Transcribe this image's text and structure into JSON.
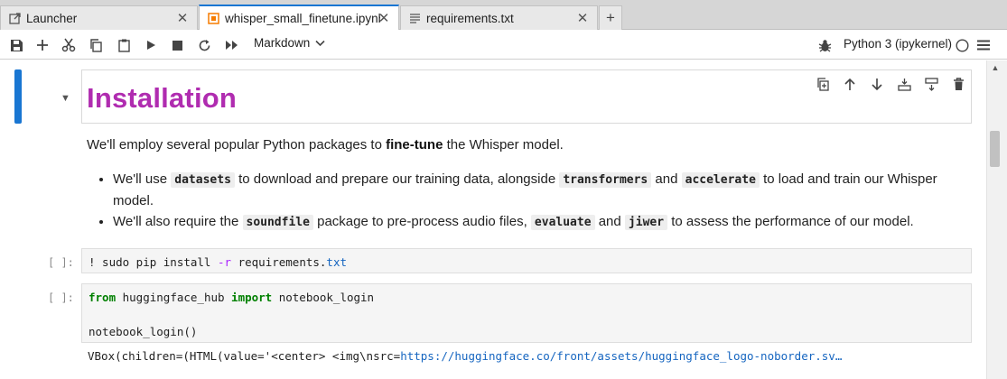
{
  "tabs": [
    {
      "label": "Launcher",
      "icon": "external-launch-icon",
      "active": false
    },
    {
      "label": "whisper_small_finetune.ipynb",
      "icon": "notebook-icon",
      "active": true
    },
    {
      "label": "requirements.txt",
      "icon": "text-file-icon",
      "active": false
    }
  ],
  "new_tab_label": "+",
  "toolbar": {
    "cell_type": "Markdown",
    "kernel_name": "Python 3 (ipykernel)"
  },
  "notebook": {
    "heading": "Installation",
    "intro": {
      "before": "We'll employ several popular Python packages to ",
      "bold": "fine-tune",
      "after": " the Whisper model."
    },
    "bullets": [
      {
        "p1": "We'll use ",
        "c1": "datasets",
        "p2": " to download and prepare our training data, alongside ",
        "c2": "transformers",
        "p3": " and ",
        "c3": "accelerate",
        "p4": " to load and train our Whisper model."
      },
      {
        "p1": "We'll also require the ",
        "c1": "soundfile",
        "p2": " package to pre-process audio files, ",
        "c2": "evaluate",
        "p3": " and ",
        "c3": "jiwer",
        "p4": " to assess the performance of our model."
      }
    ],
    "cells": [
      {
        "prompt": "[ ]:",
        "code": {
          "a": "! sudo pip install ",
          "b": "-r",
          "c": " requirements.",
          "d": "txt"
        }
      },
      {
        "prompt": "[ ]:",
        "code": {
          "kw1": "from",
          "mod": " huggingface_hub ",
          "kw2": "import",
          "name": " notebook_login",
          "line2": "notebook_login()"
        },
        "output": {
          "pre": "VBox(children=(HTML(value='<center> <img\\nsrc=",
          "url": "https://huggingface.co/front/assets/huggingface_logo-noborder.sv…"
        }
      }
    ]
  },
  "colors": {
    "accent": "#1976d2",
    "heading": "#b02cb0",
    "keyword": "#008000"
  }
}
